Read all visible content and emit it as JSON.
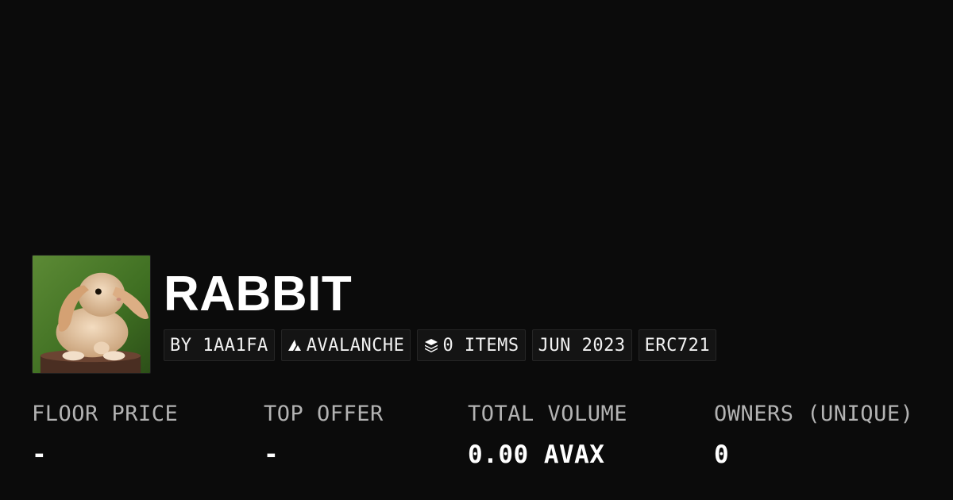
{
  "collection": {
    "name": "RABBIT",
    "image_icon": "rabbit-avatar"
  },
  "tags": [
    {
      "label": "BY 1AA1FA",
      "icon": null
    },
    {
      "label": "AVALANCHE",
      "icon": "avalanche-icon"
    },
    {
      "label": "0 ITEMS",
      "icon": "layers-icon"
    },
    {
      "label": "JUN 2023",
      "icon": null
    },
    {
      "label": "ERC721",
      "icon": null
    }
  ],
  "stats": [
    {
      "label": "FLOOR PRICE",
      "value": "-"
    },
    {
      "label": "TOP OFFER",
      "value": "-"
    },
    {
      "label": "TOTAL VOLUME",
      "value": "0.00 AVAX"
    },
    {
      "label": "OWNERS (UNIQUE)",
      "value": "0"
    }
  ],
  "colors": {
    "background": "#0b0b0b",
    "text": "#ffffff",
    "muted": "#b3b3b3",
    "tag_bg": "#141414"
  }
}
